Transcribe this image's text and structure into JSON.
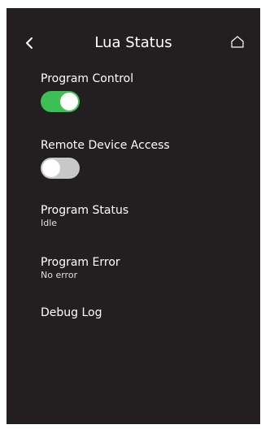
{
  "header": {
    "title": "Lua Status",
    "back_icon": "chevron-left-icon",
    "home_icon": "home-icon"
  },
  "program_control": {
    "label": "Program Control",
    "enabled": true
  },
  "remote_access": {
    "label": "Remote Device Access",
    "enabled": false
  },
  "program_status": {
    "label": "Program Status",
    "value": "Idle"
  },
  "program_error": {
    "label": "Program Error",
    "value": "No error"
  },
  "debug_log": {
    "label": "Debug Log"
  },
  "colors": {
    "background": "#231f20",
    "toggle_on": "#3cbf55",
    "toggle_off": "#c8c8c8"
  }
}
